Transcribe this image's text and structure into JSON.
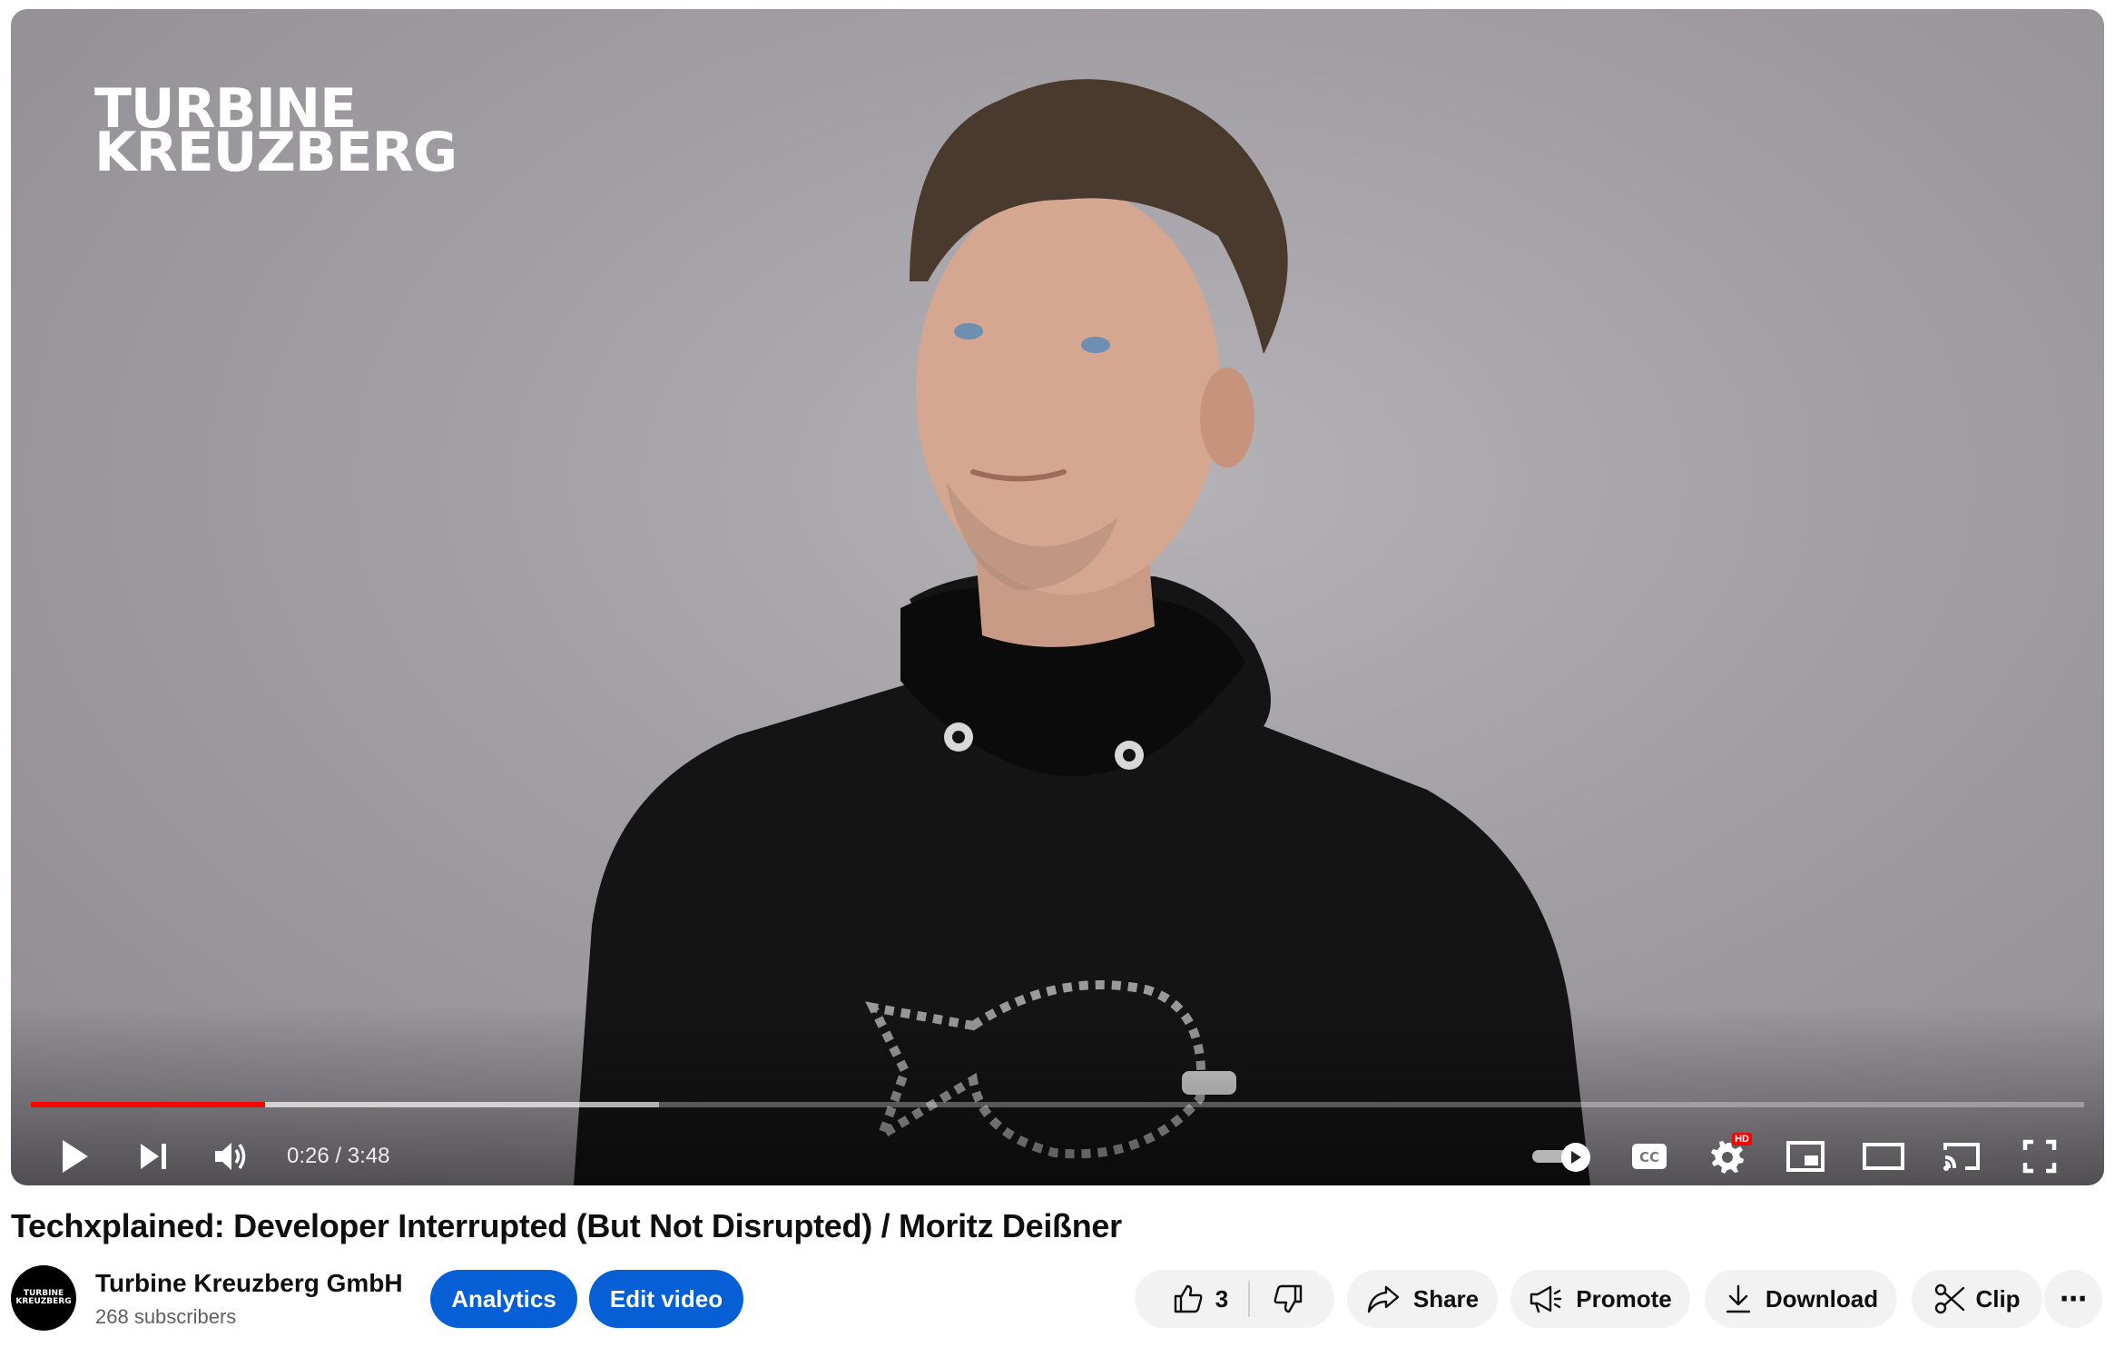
{
  "player": {
    "watermark": {
      "line1": "TURBINE",
      "line2": "KREUZBERG"
    },
    "progress": {
      "played_fraction": 0.114,
      "buffered_fraction": 0.306
    },
    "time": {
      "current": "0:26",
      "duration": "3:48",
      "display": "0:26 / 3:48"
    },
    "autoplay_on": true,
    "settings_badge": "HD",
    "icons": [
      "play-icon",
      "next-icon",
      "volume-icon",
      "autoplay-toggle",
      "captions-icon",
      "settings-icon",
      "miniplayer-icon",
      "theater-icon",
      "cast-icon",
      "fullscreen-icon"
    ],
    "accent_color": "#ff0000"
  },
  "video": {
    "title": "Techxplained: Developer Interrupted (But Not Disrupted) / Moritz Deißner"
  },
  "channel": {
    "avatar_text_line1": "TURBINE",
    "avatar_text_line2": "KREUZBERG",
    "name": "Turbine Kreuzberg GmbH",
    "subscribers": "268 subscribers"
  },
  "actions": {
    "analytics_label": "Analytics",
    "edit_label": "Edit video",
    "like_count": "3",
    "share_label": "Share",
    "promote_label": "Promote",
    "download_label": "Download",
    "clip_label": "Clip",
    "more_label": "⋯",
    "primary_color": "#065fd4"
  }
}
